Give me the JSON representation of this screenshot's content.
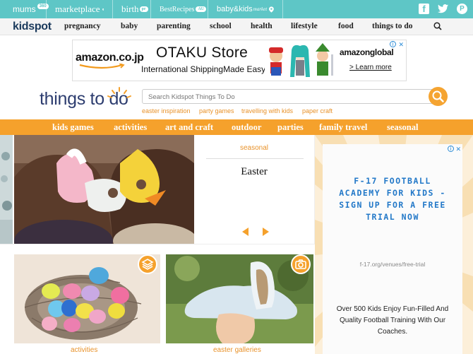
{
  "network_bar": {
    "items": [
      {
        "label": "mums",
        "sup": "360"
      },
      {
        "label": "marketplace"
      },
      {
        "label": "birth",
        "sup": "pr"
      },
      {
        "label": "BestRecipes",
        "sup": "AU"
      },
      {
        "label": "baby&kids",
        "suffix": "market"
      }
    ],
    "social": [
      "facebook-icon",
      "twitter-icon",
      "pinterest-icon"
    ]
  },
  "main_nav": {
    "logo": "kidspot",
    "items": [
      "pregnancy",
      "baby",
      "parenting",
      "school",
      "health",
      "lifestyle",
      "food",
      "things to do"
    ]
  },
  "top_ad": {
    "brand": "amazon.co.jp",
    "headline": "OTAKU Store",
    "subline": "International ShippingMade Easy",
    "brand_global": "amazonglobal",
    "cta": "> Learn more"
  },
  "things_to_do": {
    "logo": "things to do",
    "search_placeholder": "Search Kidspot Things To Do",
    "quick_links": [
      "easter inspiration",
      "party games",
      "travelling with kids",
      "paper craft"
    ]
  },
  "categories": [
    "kids games",
    "activities",
    "art and craft",
    "outdoor",
    "parties",
    "family travel",
    "seasonal"
  ],
  "feature": {
    "tag": "seasonal",
    "title": "Easter"
  },
  "tiles": [
    {
      "caption": "activities",
      "badge": "layers-icon"
    },
    {
      "caption": "easter galleries",
      "badge": "camera-icon"
    }
  ],
  "right_ad": {
    "headline": "F-17 FOOTBALL ACADEMY FOR KIDS - SIGN UP FOR A FREE TRIAL NOW",
    "url": "f-17.org/venues/free-trial",
    "body": "Over 500 Kids Enjoy Fun-Filled And Quality Football Training With Our Coaches."
  },
  "colors": {
    "teal": "#5ec6c6",
    "orange": "#f5a12c",
    "navy": "#2d3d6f",
    "ad_blue": "#2278c8"
  }
}
